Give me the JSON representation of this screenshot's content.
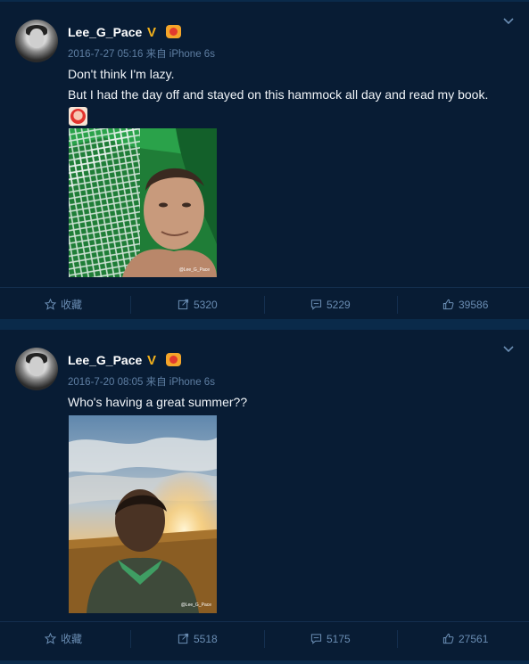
{
  "posts": [
    {
      "user": "Lee_G_Pace",
      "verified_mark": "V",
      "meta": "2016-7-27 05:16 来自 iPhone 6s",
      "lines": [
        "Don't think I'm lazy.",
        "But I had the day off and stayed on this hammock all day and read my book."
      ],
      "photo_watermark": "@Lee_G_Pace",
      "actions": {
        "favorite": "收藏",
        "repost": "5320",
        "comment": "5229",
        "like": "39586"
      }
    },
    {
      "user": "Lee_G_Pace",
      "verified_mark": "V",
      "meta": "2016-7-20 08:05 来自 iPhone 6s",
      "lines": [
        "Who's having a great summer??"
      ],
      "photo_watermark": "@Lee_G_Pace",
      "actions": {
        "favorite": "收藏",
        "repost": "5518",
        "comment": "5175",
        "like": "27561"
      }
    }
  ],
  "colors": {
    "background": "#0a2a4a",
    "card": "#081c34",
    "muted": "#6a8db3",
    "vip": "#f5b31c"
  }
}
